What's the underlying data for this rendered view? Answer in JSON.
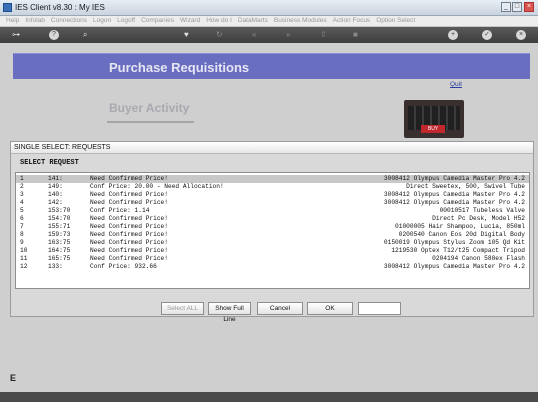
{
  "window": {
    "title": "IES Client v8.30 : My IES",
    "min": "_",
    "max": "□",
    "close": "×"
  },
  "menu": [
    {
      "label": "Help",
      "active": true
    },
    {
      "label": "Infolab",
      "active": true
    },
    {
      "label": "Connections",
      "active": false
    },
    {
      "label": "Logon",
      "active": false
    },
    {
      "label": "Logoff",
      "active": true
    },
    {
      "label": "Companies",
      "active": false
    },
    {
      "label": "Wizard",
      "active": false
    },
    {
      "label": "How do I",
      "active": false
    },
    {
      "label": "DataMarts",
      "active": false
    },
    {
      "label": "Business Modules",
      "active": false
    },
    {
      "label": "Action Focus",
      "active": false
    },
    {
      "label": "Option Select",
      "active": false
    }
  ],
  "toolbar": {
    "icons": [
      {
        "name": "key-icon",
        "glyph": "⊶"
      },
      {
        "name": "help-icon",
        "glyph": "?"
      },
      {
        "name": "search-icon",
        "glyph": "⌕"
      },
      {
        "name": "heart-icon",
        "glyph": "♥"
      },
      {
        "name": "refresh-icon",
        "glyph": "↻"
      },
      {
        "name": "rewind-icon",
        "glyph": "«"
      },
      {
        "name": "forward-icon",
        "glyph": "»"
      },
      {
        "name": "upload-icon",
        "glyph": "⇧"
      },
      {
        "name": "stop-icon",
        "glyph": "■"
      },
      {
        "name": "add-icon",
        "glyph": "+"
      },
      {
        "name": "check-icon",
        "glyph": "✓"
      },
      {
        "name": "close-icon",
        "glyph": "×"
      }
    ]
  },
  "page": {
    "banner_title": "Purchase Requisitions",
    "quit_link": "Quit",
    "subtitle": "Buyer Activity",
    "photo_button": "BUY",
    "side_letter": "E"
  },
  "dialog": {
    "title": "SINGLE SELECT: REQUESTS",
    "heading": "SELECT REQUEST",
    "rows": [
      {
        "idx": "1",
        "code": "141:",
        "status": "Need Confirmed Price!",
        "product": "3008412 Olympus Camedia Master Pro 4.2"
      },
      {
        "idx": "2",
        "code": "149:",
        "status": "Conf Price: 20.00 - Need Allocation!",
        "product": "Direct Sweetex, 500, Swivel Tube"
      },
      {
        "idx": "3",
        "code": "140:",
        "status": "Need Confirmed Price!",
        "product": "3008412 Olympus Camedia Master Pro 4.2"
      },
      {
        "idx": "4",
        "code": "142:",
        "status": "Need Confirmed Price!",
        "product": "3008412 Olympus Camedia Master Pro 4.2"
      },
      {
        "idx": "5",
        "code": "153:70",
        "status": "Conf Price: 1.14",
        "product": "00010517 Tubeless Valve"
      },
      {
        "idx": "6",
        "code": "154:70",
        "status": "Need Confirmed Price!",
        "product": "Direct Pc Desk, Model H52"
      },
      {
        "idx": "7",
        "code": "155:71",
        "status": "Need Confirmed Price!",
        "product": "01000005 Hair Shampoo, Lucia, 850ml"
      },
      {
        "idx": "8",
        "code": "159:73",
        "status": "Need Confirmed Price!",
        "product": "0200540 Canon Eos 20d Digital Body"
      },
      {
        "idx": "9",
        "code": "163:75",
        "status": "Need Confirmed Price!",
        "product": "0150019 Olympus Stylus Zoom 105 Qd Kit"
      },
      {
        "idx": "10",
        "code": "164:75",
        "status": "Need Confirmed Price!",
        "product": "1219530 Optex T12/t25 Compact Tripod"
      },
      {
        "idx": "11",
        "code": "165:75",
        "status": "Need Confirmed Price!",
        "product": "0204194 Canon 580ex Flash"
      },
      {
        "idx": "12",
        "code": "133:",
        "status": "Conf Price: 932.66",
        "product": "3008412 Olympus Camedia Master Pro 4.2"
      }
    ],
    "buttons": {
      "select_all": "Select ALL",
      "show_full_line": "Show Full Line",
      "cancel": "Cancel",
      "ok": "OK"
    },
    "entry_value": ""
  }
}
